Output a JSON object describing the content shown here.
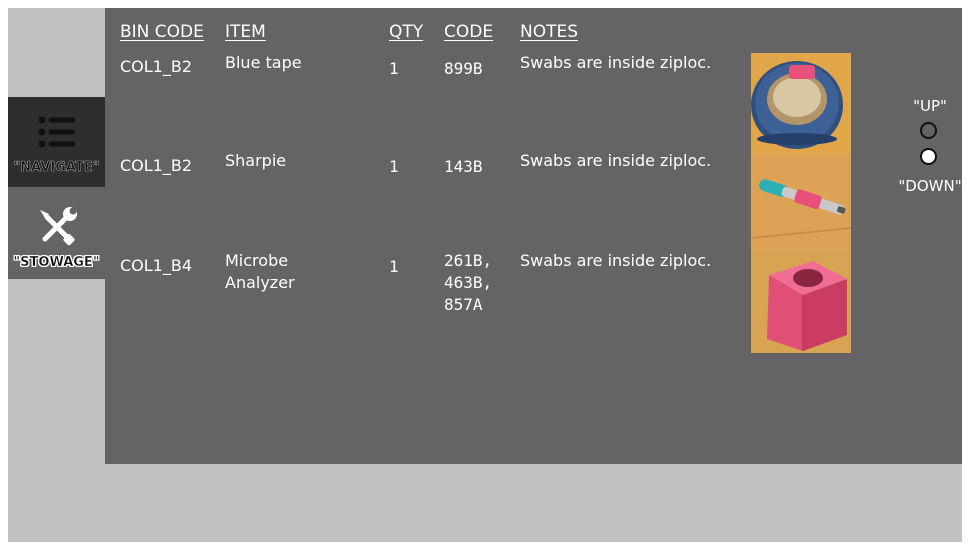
{
  "sidebar": {
    "navigate": {
      "label": "\"NAVIGATE\"",
      "icon": "list-icon"
    },
    "stowage": {
      "label": "\"STOWAGE\"",
      "icon": "tools-icon"
    }
  },
  "table": {
    "headers": [
      "BIN CODE",
      "ITEM",
      "QTY",
      "CODE",
      "NOTES"
    ],
    "rows": [
      {
        "bin": "COL1_B2",
        "item": "Blue tape",
        "qty": "1",
        "code": "899B",
        "notes": "Swabs are inside ziploc.",
        "image": "blue-tape-roll-photo"
      },
      {
        "bin": "COL1_B2",
        "item": "Sharpie",
        "qty": "1",
        "code": "143B",
        "notes": "Swabs are inside ziploc.",
        "image": "sharpie-marker-photo"
      },
      {
        "bin": "COL1_B4",
        "item": "Microbe\nAnalyzer",
        "qty": "1",
        "code": "261B,\n463B,\n857A",
        "notes": "Swabs are inside ziploc.",
        "image": "pink-cube-photo"
      }
    ]
  },
  "scroll": {
    "up_label": "\"UP\"",
    "down_label": "\"DOWN\""
  },
  "colors": {
    "panel": "#646464",
    "frame": "#c2c2c2",
    "active_tab": "#2e2e2e",
    "photo_background": "#e3a74a",
    "tape_blue": "#3a5d8f",
    "pink": "#e8507a"
  }
}
